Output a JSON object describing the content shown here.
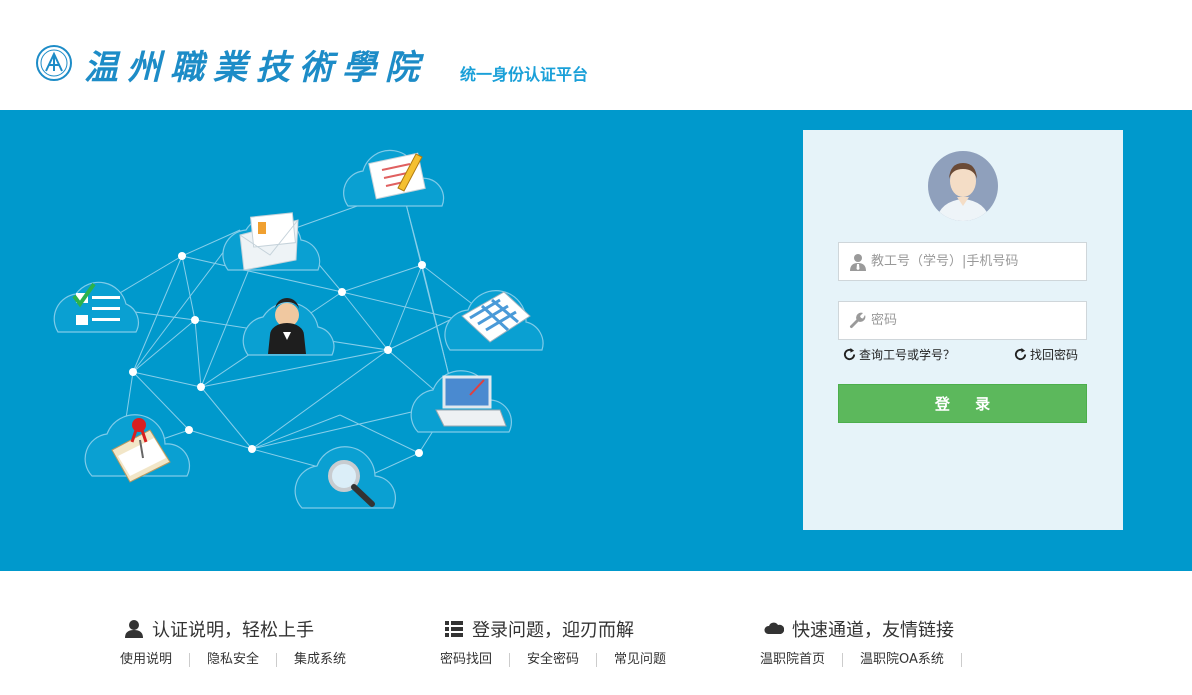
{
  "header": {
    "school_name": "温州職業技術學院",
    "platform_title": "统一身份认证平台"
  },
  "login": {
    "username_placeholder": "教工号（学号）|手机号码",
    "password_placeholder": "密码",
    "query_id_link": "查询工号或学号？",
    "retrieve_password_link": "找回密码",
    "login_button": "登 录"
  },
  "footer": {
    "col1": {
      "icon": "user-icon",
      "title": "认证说明，轻松上手",
      "links": [
        "使用说明",
        "隐私安全",
        "集成系统"
      ]
    },
    "col2": {
      "icon": "list-icon",
      "title": "登录问题，迎刃而解",
      "links": [
        "密码找回",
        "安全密码",
        "常见问题"
      ]
    },
    "col3": {
      "icon": "cloud-icon",
      "title": "快速通道，友情链接",
      "links": [
        "温职院首页",
        "温职院OA系统"
      ]
    }
  },
  "colors": {
    "banner": "#0099cc",
    "panel": "#e6f3f9",
    "login_button": "#5cb85c",
    "brand_text": "#1d8cc7"
  }
}
